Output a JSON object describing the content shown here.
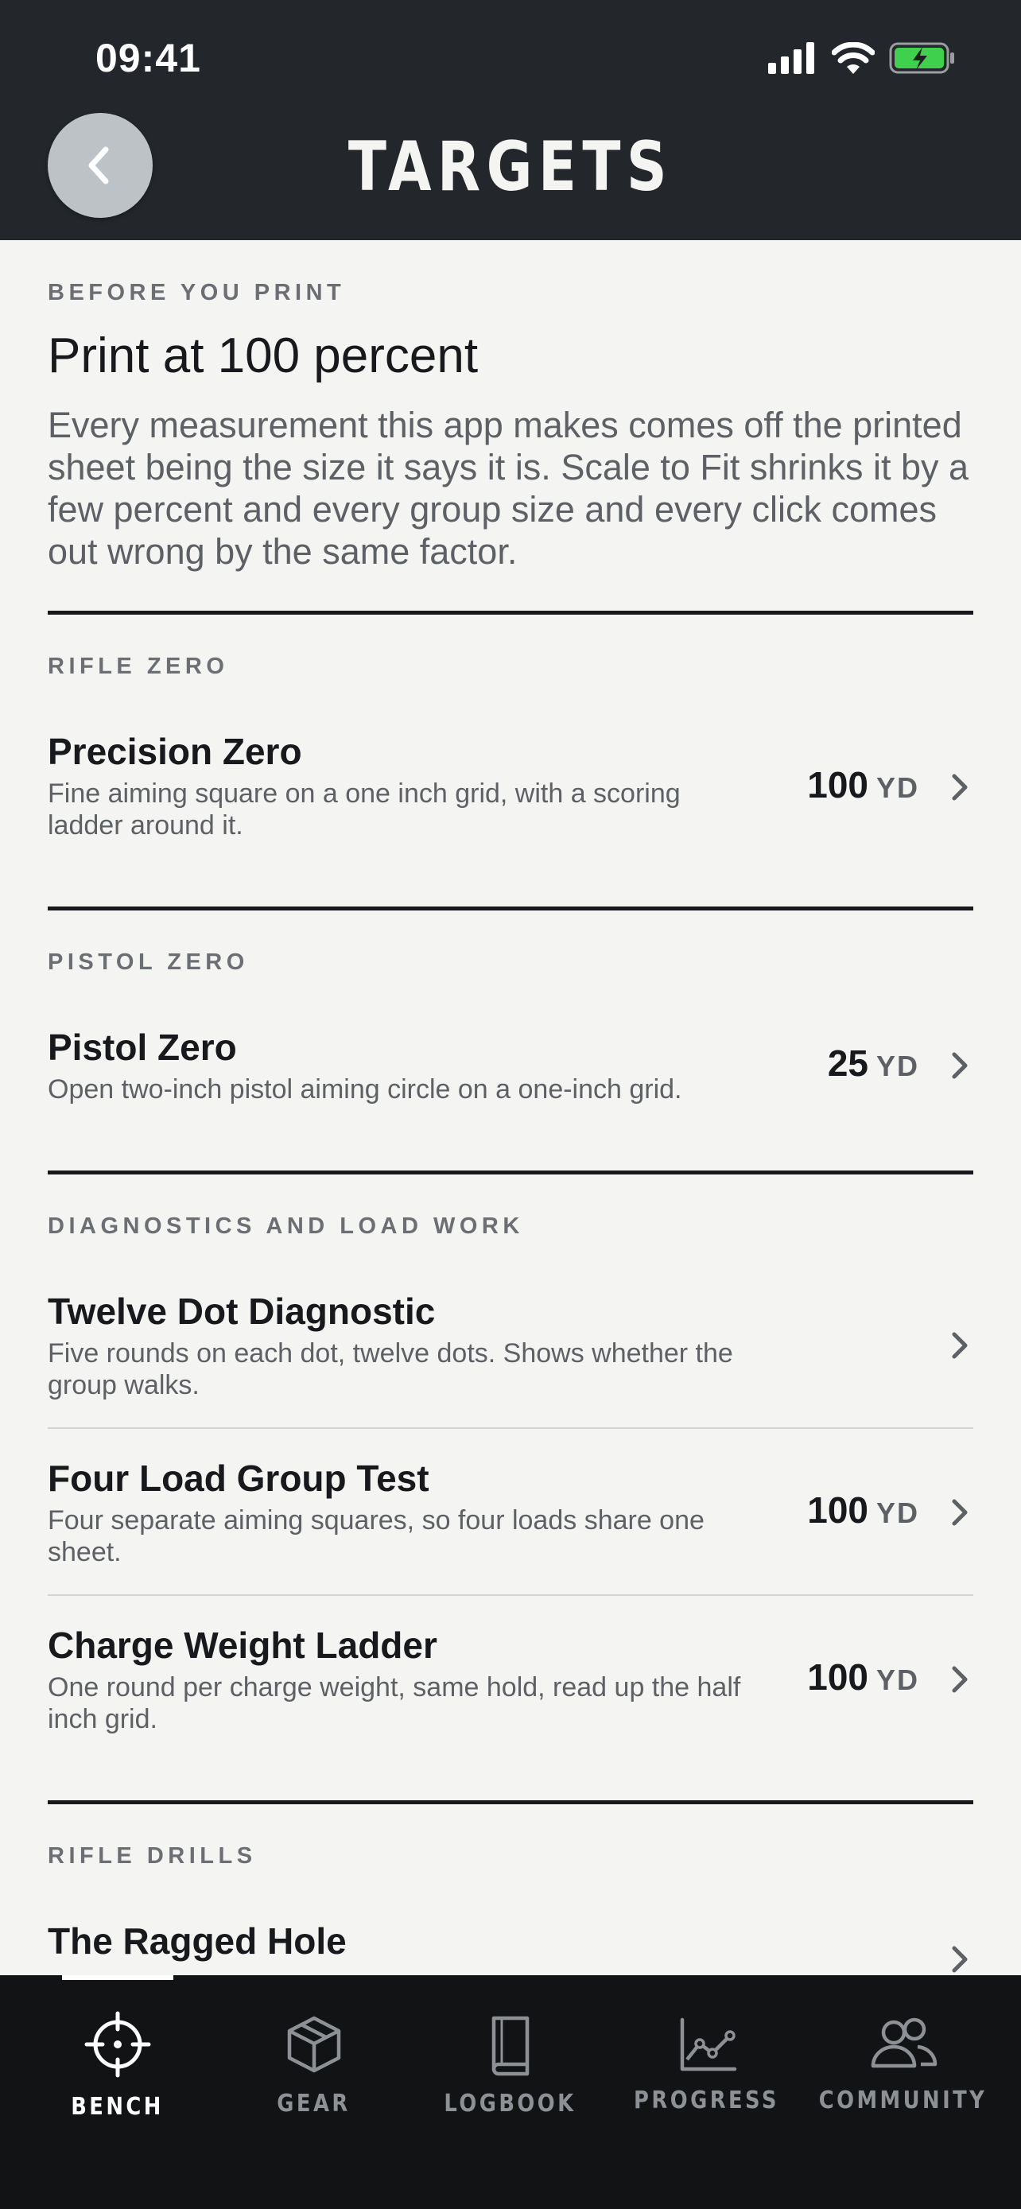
{
  "status_bar": {
    "time": "09:41"
  },
  "header": {
    "title": "TARGETS"
  },
  "intro": {
    "section_label": "BEFORE YOU PRINT",
    "title": "Print at 100 percent",
    "body": "Every measurement this app makes comes off the printed sheet being the size it says it is. Scale to Fit shrinks it by a few percent and every group size and every click comes out wrong by the same factor."
  },
  "sections": [
    {
      "label": "RIFLE ZERO",
      "items": [
        {
          "title": "Precision Zero",
          "description": "Fine aiming square on a one inch grid, with a scoring ladder around it.",
          "distance": "100",
          "unit": "YD"
        }
      ]
    },
    {
      "label": "PISTOL ZERO",
      "items": [
        {
          "title": "Pistol Zero",
          "description": "Open two-inch pistol aiming circle on a one-inch grid.",
          "distance": "25",
          "unit": "YD"
        }
      ]
    },
    {
      "label": "DIAGNOSTICS AND LOAD WORK",
      "items": [
        {
          "title": "Twelve Dot Diagnostic",
          "description": "Five rounds on each dot, twelve dots. Shows whether the group walks."
        },
        {
          "title": "Four Load Group Test",
          "description": "Four separate aiming squares, so four loads share one sheet.",
          "distance": "100",
          "unit": "YD"
        },
        {
          "title": "Charge Weight Ladder",
          "description": "One round per charge weight, same hold, read up the half inch grid.",
          "distance": "100",
          "unit": "YD"
        }
      ]
    },
    {
      "label": "RIFLE DRILLS",
      "items": [
        {
          "title": "The Ragged Hole"
        }
      ]
    }
  ],
  "tabbar": {
    "active": "bench",
    "tabs": [
      {
        "id": "bench",
        "label": "BENCH",
        "icon": "crosshair-icon"
      },
      {
        "id": "gear",
        "label": "GEAR",
        "icon": "box-icon"
      },
      {
        "id": "logbook",
        "label": "LOGBOOK",
        "icon": "book-icon"
      },
      {
        "id": "progress",
        "label": "PROGRESS",
        "icon": "line-chart-icon"
      },
      {
        "id": "community",
        "label": "COMMUNITY",
        "icon": "people-icon"
      }
    ]
  },
  "colors": {
    "header_bg": "#23262a",
    "page_bg": "#f4f4f2",
    "tabbar_bg": "#111315",
    "battery_green": "#3fd14d",
    "muted_text": "#5d6064"
  }
}
